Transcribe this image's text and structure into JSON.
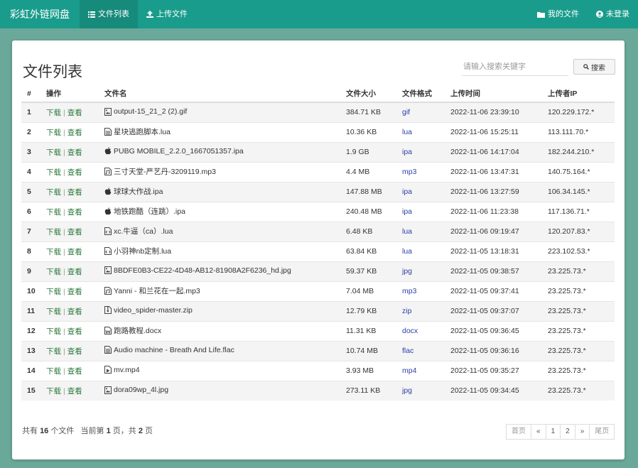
{
  "app": {
    "brand": "彩虹外链网盘",
    "nav": {
      "file_list": "文件列表",
      "upload": "上传文件",
      "my_files": "我的文件",
      "login": "未登录"
    }
  },
  "colors": {
    "navbar": "#1a9c8c",
    "link_green": "#2c7a3c",
    "format_blue": "#2a3fa8"
  },
  "panel": {
    "title": "文件列表",
    "search": {
      "placeholder": "请输入搜索关键字",
      "value": "",
      "button": "搜索"
    }
  },
  "table": {
    "headers": {
      "num": "#",
      "op": "操作",
      "name": "文件名",
      "size": "文件大小",
      "format": "文件格式",
      "time": "上传时间",
      "ip": "上传者IP"
    },
    "op_download": "下载",
    "op_sep": "|",
    "op_view": "查看",
    "rows": [
      {
        "num": "1",
        "icon": "image-file-icon",
        "name": "output-15_21_2 (2).gif",
        "size": "384.71 KB",
        "format": "gif",
        "time": "2022-11-06 23:39:10",
        "ip": "120.229.172.*"
      },
      {
        "num": "2",
        "icon": "document-file-icon",
        "name": "星块逃跑脚本.lua",
        "size": "10.36 KB",
        "format": "lua",
        "time": "2022-11-06 15:25:11",
        "ip": "113.111.70.*"
      },
      {
        "num": "3",
        "icon": "apple-icon",
        "name": "PUBG MOBILE_2.2.0_1667051357.ipa",
        "size": "1.9 GB",
        "format": "ipa",
        "time": "2022-11-06 14:17:04",
        "ip": "182.244.210.*"
      },
      {
        "num": "4",
        "icon": "audio-file-icon",
        "name": "三寸天堂-严艺丹-3209119.mp3",
        "size": "4.4 MB",
        "format": "mp3",
        "time": "2022-11-06 13:47:31",
        "ip": "140.75.164.*"
      },
      {
        "num": "5",
        "icon": "apple-icon",
        "name": "球球大作战.ipa",
        "size": "147.88 MB",
        "format": "ipa",
        "time": "2022-11-06 13:27:59",
        "ip": "106.34.145.*"
      },
      {
        "num": "6",
        "icon": "apple-icon",
        "name": "地铁跑酷（连跳）.ipa",
        "size": "240.48 MB",
        "format": "ipa",
        "time": "2022-11-06 11:23:38",
        "ip": "117.136.71.*"
      },
      {
        "num": "7",
        "icon": "code-file-icon",
        "name": "xc.牛逼（ca）.lua",
        "size": "6.48 KB",
        "format": "lua",
        "time": "2022-11-06 09:19:47",
        "ip": "120.207.83.*"
      },
      {
        "num": "8",
        "icon": "code-file-icon",
        "name": "小羽神nb定制.lua",
        "size": "63.84 KB",
        "format": "lua",
        "time": "2022-11-05 13:18:31",
        "ip": "223.102.53.*"
      },
      {
        "num": "9",
        "icon": "image-file-icon",
        "name": "8BDFE0B3-CE22-4D48-AB12-81908A2F6236_hd.jpg",
        "size": "59.37 KB",
        "format": "jpg",
        "time": "2022-11-05 09:38:57",
        "ip": "23.225.73.*"
      },
      {
        "num": "10",
        "icon": "audio-file-icon",
        "name": "Yanni - 和兰花在一起.mp3",
        "size": "7.04 MB",
        "format": "mp3",
        "time": "2022-11-05 09:37:41",
        "ip": "23.225.73.*"
      },
      {
        "num": "11",
        "icon": "archive-file-icon",
        "name": "video_spider-master.zip",
        "size": "12.79 KB",
        "format": "zip",
        "time": "2022-11-05 09:37:07",
        "ip": "23.225.73.*"
      },
      {
        "num": "12",
        "icon": "word-file-icon",
        "name": "跑路教程.docx",
        "size": "11.31 KB",
        "format": "docx",
        "time": "2022-11-05 09:36:45",
        "ip": "23.225.73.*"
      },
      {
        "num": "13",
        "icon": "document-file-icon",
        "name": "Audio machine - Breath And Life.flac",
        "size": "10.74 MB",
        "format": "flac",
        "time": "2022-11-05 09:36:16",
        "ip": "23.225.73.*"
      },
      {
        "num": "14",
        "icon": "video-file-icon",
        "name": "mv.mp4",
        "size": "3.93 MB",
        "format": "mp4",
        "time": "2022-11-05 09:35:27",
        "ip": "23.225.73.*"
      },
      {
        "num": "15",
        "icon": "image-file-icon",
        "name": "dora09wp_4l.jpg",
        "size": "273.11 KB",
        "format": "jpg",
        "time": "2022-11-05 09:34:45",
        "ip": "23.225.73.*"
      }
    ]
  },
  "footer": {
    "pre_total": "共有",
    "total": "16",
    "post_total": "个文件",
    "pre_current": "当前第",
    "current": "1",
    "post_current": "页，共",
    "pages": "2",
    "post_pages": "页",
    "pager": {
      "first": "首页",
      "prev": "«",
      "p1": "1",
      "p2": "2",
      "next": "»",
      "last": "尾页"
    }
  }
}
